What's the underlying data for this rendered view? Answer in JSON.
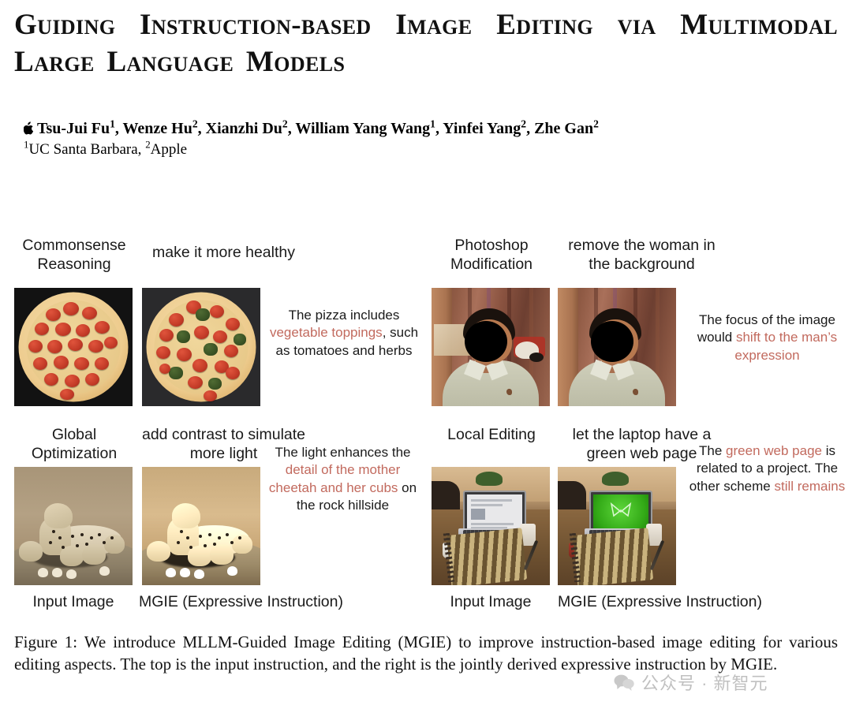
{
  "paper": {
    "title": "Guiding Instruction-based Image Editing via Multimodal Large Language Models",
    "authors_line": ", Wenze Hu, Xianzhi Du, William Yang Wang, Yinfei Yang, Zhe Gan",
    "first_author": "Tsu-Jui Fu",
    "affiliations": "UC Santa Barbara, Apple",
    "affil_1": "UC Santa Barbara, ",
    "affil_2": "Apple",
    "apple_logo_icon": "apple-logo-icon"
  },
  "figure": {
    "panels": [
      {
        "aspect": "Commonsense Reasoning",
        "instruction": "make it more healthy",
        "expressive_pre": "The pizza includes ",
        "expressive_hl": "vegetable toppings",
        "expressive_post": ", such as tomatoes and herbs",
        "input_label": "Input Image",
        "output_label": "MGIE (Expressive Instruction)"
      },
      {
        "aspect": "Photoshop Modification",
        "instruction": "remove the woman in the background",
        "expressive_pre": "The focus of the image would ",
        "expressive_hl": "shift to the man’s expression",
        "expressive_post": "",
        "input_label": "Input Image",
        "output_label": "MGIE (Expressive Instruction)"
      },
      {
        "aspect": "Global Optimization",
        "instruction": "add contrast to simulate more light",
        "expressive_pre": "The light enhances the ",
        "expressive_hl": "detail of the mother cheetah and her cubs",
        "expressive_post": " on the rock hillside",
        "input_label": "Input Image",
        "output_label": "MGIE (Expressive Instruction)"
      },
      {
        "aspect": "Local Editing",
        "instruction": "let the laptop have a green web page",
        "expressive_pre": "The ",
        "expressive_hl": "green web page",
        "expressive_mid": " is related to a project. The other scheme ",
        "expressive_hl2": "still remains",
        "expressive_post": "",
        "input_label": "Input Image",
        "output_label": "MGIE (Expressive Instruction)"
      }
    ],
    "caption_label": "Figure 1:",
    "caption_text": " We introduce MLLM-Guided Image Editing (MGIE) to improve instruction-based image editing for various editing aspects. The top is the input instruction, and the right is the jointly derived expressive instruction by MGIE."
  },
  "watermark": {
    "text": "公众号 · 新智元",
    "icon": "chat-bubble-icon"
  },
  "colors": {
    "accent_highlight": "#c26a5e",
    "text": "#111111",
    "watermark": "#9b9b9b"
  }
}
